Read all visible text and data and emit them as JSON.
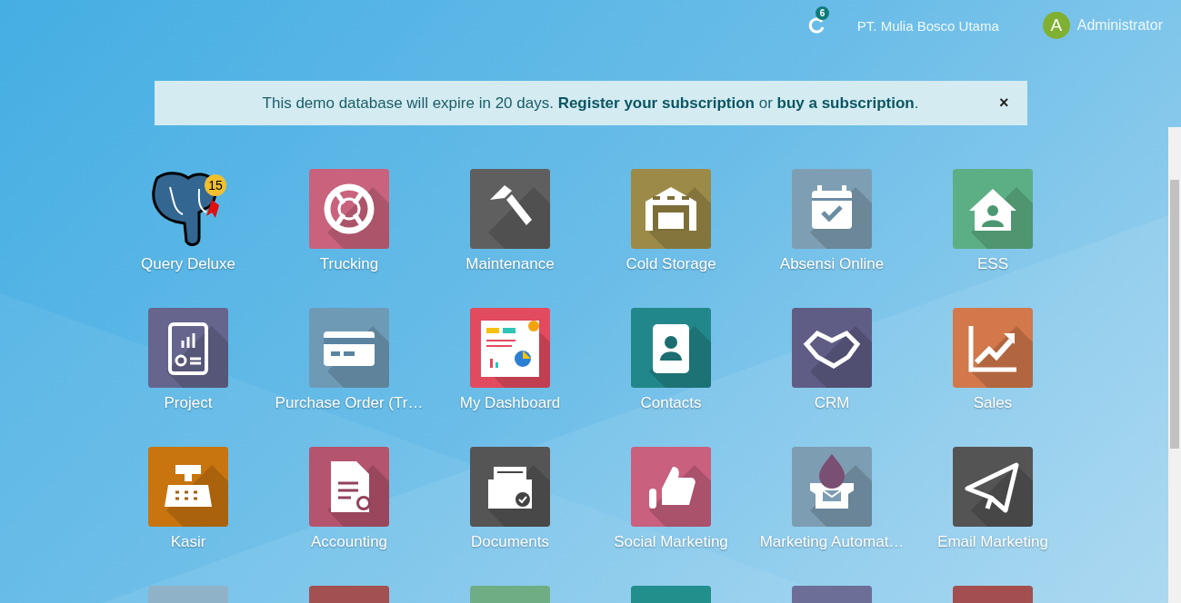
{
  "top_bar": {
    "activity_count": "6",
    "company": "PT. Mulia Bosco Utama",
    "user": {
      "initial": "A",
      "name": "Administrator"
    }
  },
  "banner": {
    "message": "This demo database will expire in 20 days. **Register your subscription** or **buy a subscription**.",
    "close": "×"
  },
  "apps": [
    {
      "label": "Query Deluxe",
      "kind": "logo",
      "badge": "15"
    },
    {
      "label": "Trucking",
      "kind": "tile",
      "color": "#c9637d"
    },
    {
      "label": "Maintenance",
      "kind": "tile",
      "color": "#5f5f5f"
    },
    {
      "label": "Cold Storage",
      "kind": "tile",
      "color": "#9c8a48"
    },
    {
      "label": "Absensi Online",
      "kind": "tile",
      "color": "#7e9fb3"
    },
    {
      "label": "ESS",
      "kind": "tile",
      "color": "#5caf84"
    },
    {
      "label": "Project",
      "kind": "tile",
      "color": "#65658e"
    },
    {
      "label": "Purchase Order (Tr…",
      "kind": "tile",
      "color": "#6f9ab5"
    },
    {
      "label": "My Dashboard",
      "kind": "tile",
      "color": "#e24a5f"
    },
    {
      "label": "Contacts",
      "kind": "tile",
      "color": "#22878a"
    },
    {
      "label": "CRM",
      "kind": "tile",
      "color": "#5f5d85"
    },
    {
      "label": "Sales",
      "kind": "tile",
      "color": "#d2784a"
    },
    {
      "label": "Kasir",
      "kind": "tile",
      "color": "#c8750f"
    },
    {
      "label": "Accounting",
      "kind": "tile",
      "color": "#b5546f"
    },
    {
      "label": "Documents",
      "kind": "tile",
      "color": "#555555"
    },
    {
      "label": "Social Marketing",
      "kind": "tile",
      "color": "#c8607e"
    },
    {
      "label": "Marketing Automat…",
      "kind": "tile",
      "color": "#7d9db2"
    },
    {
      "label": "Email Marketing",
      "kind": "tile",
      "color": "#545454"
    },
    {
      "kind": "tile",
      "color": "#8fb2c8"
    },
    {
      "kind": "tile",
      "color": "#a35050"
    },
    {
      "kind": "tile",
      "color": "#6fae84"
    },
    {
      "kind": "tile",
      "color": "#238f8d"
    },
    {
      "kind": "tile",
      "color": "#6c6e98"
    },
    {
      "kind": "tile",
      "color": "#a34f4f"
    }
  ]
}
